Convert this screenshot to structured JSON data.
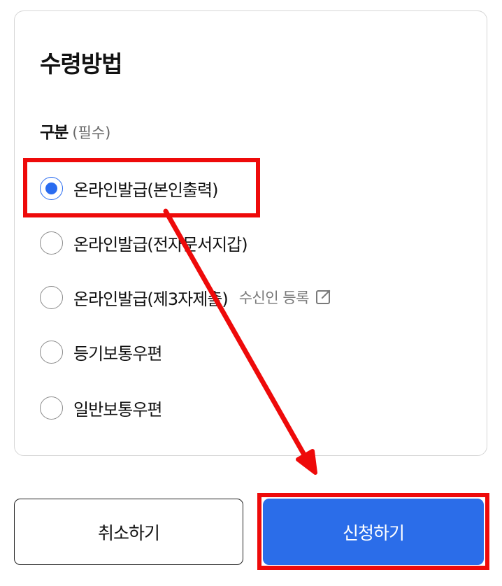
{
  "section": {
    "title": "수령방법"
  },
  "field": {
    "label": "구분",
    "required_note": "(필수)"
  },
  "options": [
    {
      "label": "온라인발급(본인출력)",
      "checked": true
    },
    {
      "label": "온라인발급(전자문서지갑)",
      "checked": false
    },
    {
      "label": "온라인발급(제3자제출)",
      "checked": false,
      "link_label": "수신인 등록",
      "link_icon": "external-link-icon"
    },
    {
      "label": "등기보통우편",
      "checked": false
    },
    {
      "label": "일반보통우편",
      "checked": false
    }
  ],
  "buttons": {
    "cancel_label": "취소하기",
    "submit_label": "신청하기"
  },
  "colors": {
    "accent": "#2b6de9",
    "annotation": "#ee0a0a"
  }
}
